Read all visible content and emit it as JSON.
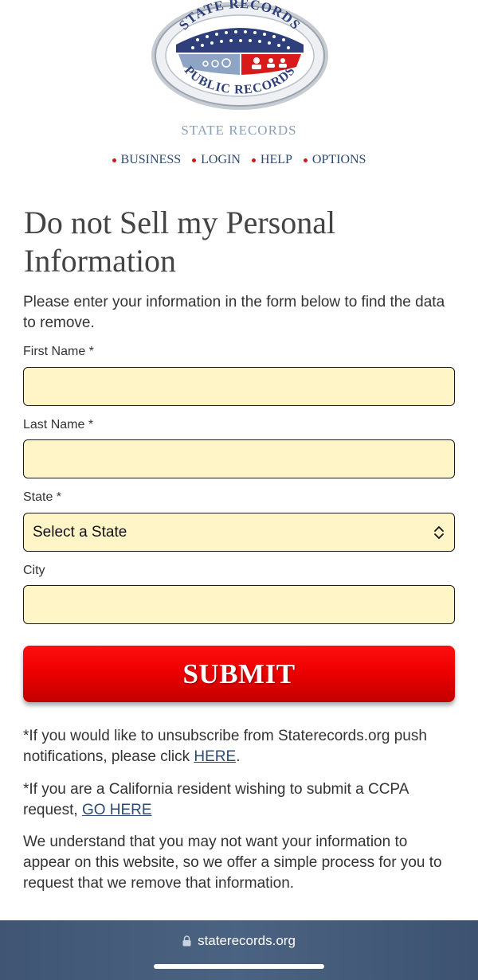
{
  "logo": {
    "top_text": "STATE RECORDS",
    "bottom_text": "PUBLIC RECORDS",
    "icon": "state-records-seal"
  },
  "brand_name": "STATE RECORDS",
  "nav": {
    "items": [
      {
        "label": "BUSINESS"
      },
      {
        "label": "LOGIN"
      },
      {
        "label": "HELP"
      },
      {
        "label": "OPTIONS"
      }
    ]
  },
  "page": {
    "title": "Do not Sell my Personal Information",
    "intro": "Please enter your information in the form below to find the data to remove."
  },
  "form": {
    "first_name_label": "First Name *",
    "first_name_value": "",
    "last_name_label": "Last Name *",
    "last_name_value": "",
    "state_label": "State *",
    "state_value": "Select a State",
    "city_label": "City",
    "city_value": "",
    "submit_label": "SUBMIT"
  },
  "notes": {
    "unsubscribe_before": "*If you would like to unsubscribe from Staterecords.org push notifications, please click ",
    "unsubscribe_link": "HERE",
    "unsubscribe_after": ".",
    "ccpa_before": "*If you are a California resident wishing to submit a CCPA request, ",
    "ccpa_link": "GO HERE",
    "explanation": "We understand that you may not want your information to appear on this website, so we offer a simple process for you to request that we remove that information."
  },
  "browser": {
    "url": "staterecords.org"
  },
  "colors": {
    "accent_red": "#ee0000",
    "field_bg": "#fff5c7",
    "link": "#2d4a72",
    "bottom_bar": "#4b6382"
  }
}
